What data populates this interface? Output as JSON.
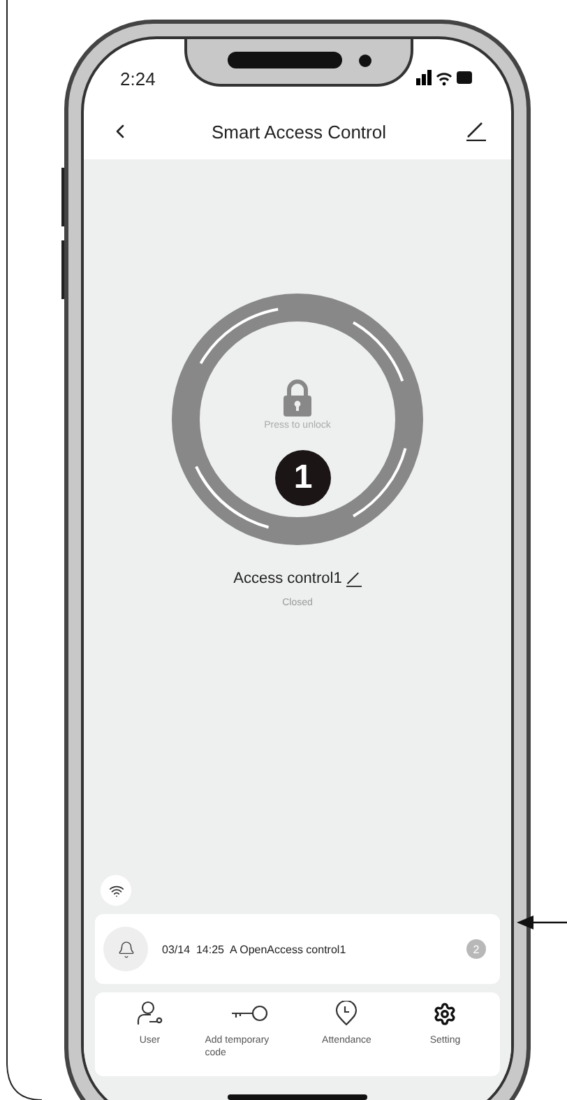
{
  "status_bar": {
    "time": "2:24"
  },
  "header": {
    "title": "Smart Access Control"
  },
  "lock": {
    "locked": true,
    "hint": "Press to unlock",
    "name": "Access control1",
    "state": "Closed"
  },
  "callout": {
    "label": "1"
  },
  "notice": {
    "text": "03/14  14:25  A OpenAccess control1",
    "badge": "2"
  },
  "nav": [
    {
      "kind": "user",
      "label": "User"
    },
    {
      "kind": "key",
      "label": "Add temporary code"
    },
    {
      "kind": "clock",
      "label": "Attendance"
    },
    {
      "kind": "gear",
      "label": "Setting"
    }
  ]
}
